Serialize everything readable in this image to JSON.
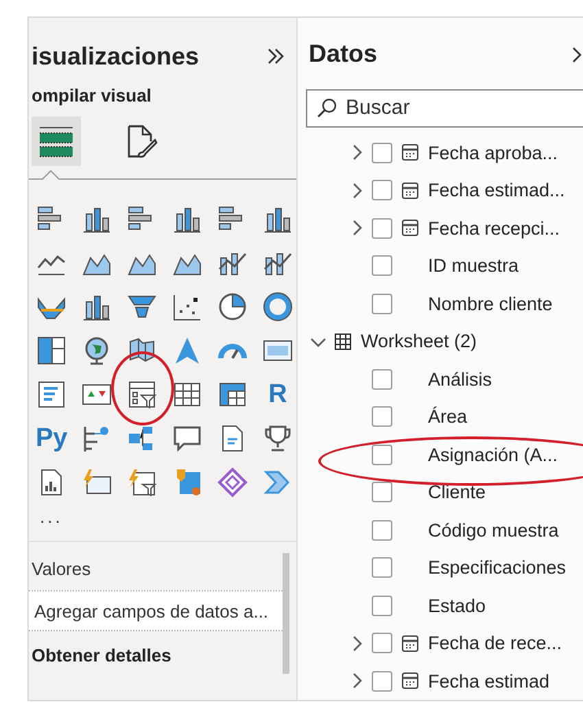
{
  "visualizations": {
    "title": "isualizaciones",
    "build_label": "ompilar visual",
    "build_tabs": [
      {
        "selected": true
      },
      {
        "selected": false
      }
    ],
    "letter_icons": [
      "R",
      "Py"
    ],
    "more": "...",
    "values_label": "Valores",
    "values_field": {
      "placeholder": "Agregar campos de datos a..."
    },
    "details_label": "Obtener detalles"
  },
  "datos": {
    "title": "Datos",
    "search": {
      "placeholder": "Buscar"
    },
    "tree": [
      {
        "children": [
          {
            "label": "Fecha aproba...",
            "kind": "date",
            "expanded": false,
            "checked": false
          },
          {
            "label": "Fecha estimad...",
            "kind": "date",
            "expanded": false,
            "checked": false
          },
          {
            "label": "Fecha recepci...",
            "kind": "date",
            "expanded": false,
            "checked": false
          },
          {
            "label": "ID muestra",
            "kind": "field",
            "checked": false
          },
          {
            "label": "Nombre cliente",
            "kind": "field",
            "checked": false
          }
        ]
      },
      {
        "label": "Worksheet (2)",
        "expanded": true,
        "children": [
          {
            "label": "Análisis",
            "kind": "field",
            "checked": false
          },
          {
            "label": "Área",
            "kind": "field",
            "checked": false
          },
          {
            "label": "Asignación (A...",
            "kind": "field",
            "checked": false
          },
          {
            "label": "Cliente",
            "kind": "field",
            "checked": false
          },
          {
            "label": "Código muestra",
            "kind": "field",
            "checked": false
          },
          {
            "label": "Especificaciones",
            "kind": "field",
            "checked": false
          },
          {
            "label": "Estado",
            "kind": "field",
            "checked": false
          },
          {
            "label": "Fecha de rece...",
            "kind": "date",
            "expanded": false,
            "checked": false
          },
          {
            "label": "Fecha estimad",
            "kind": "date",
            "expanded": false,
            "checked": false
          }
        ]
      }
    ]
  }
}
